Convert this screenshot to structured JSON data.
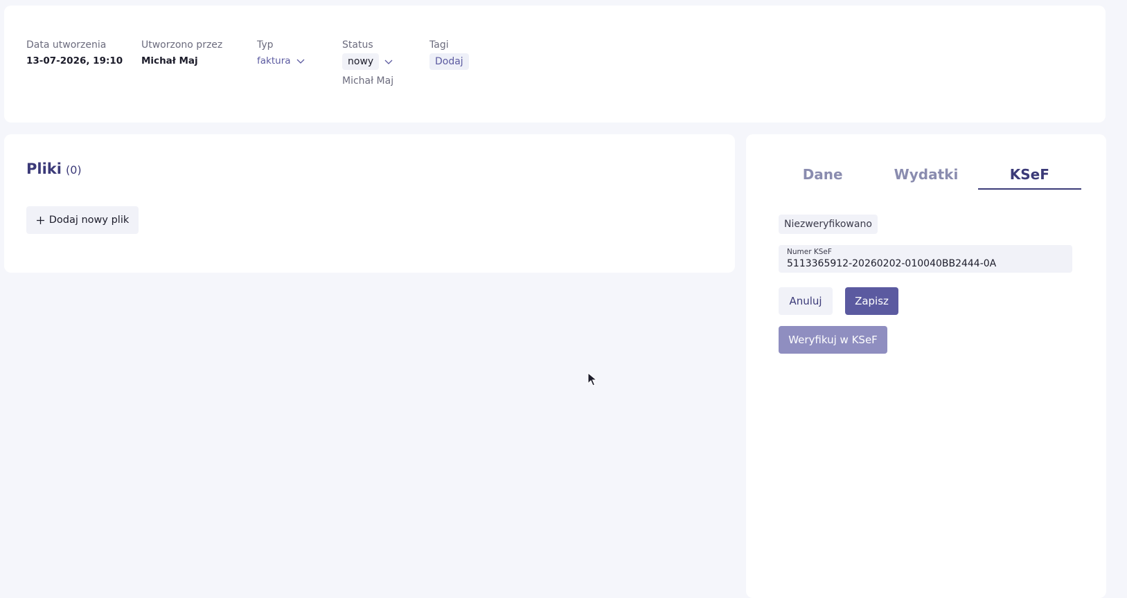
{
  "header": {
    "created_date": {
      "label": "Data utworzenia",
      "value": "13-07-2026, 19:10"
    },
    "created_by": {
      "label": "Utworzono przez",
      "value": "Michał Maj"
    },
    "type": {
      "label": "Typ",
      "value": "faktura"
    },
    "status": {
      "label": "Status",
      "value": "nowy",
      "assignee": "Michał Maj"
    },
    "tags": {
      "label": "Tagi",
      "add_label": "Dodaj"
    }
  },
  "files": {
    "title": "Pliki",
    "count": "(0)",
    "add_button": "Dodaj nowy plik"
  },
  "side_panel": {
    "tabs": [
      {
        "label": "Dane",
        "active": false
      },
      {
        "label": "Wydatki",
        "active": false
      },
      {
        "label": "KSeF",
        "active": true
      }
    ],
    "verification_status": "Niezweryfikowano",
    "ksef_number": {
      "label": "Numer KSeF",
      "value": "5113365912-20260202-010040BB2444-0A"
    },
    "cancel_button": "Anuluj",
    "save_button": "Zapisz",
    "verify_button": "Weryfikuj w KSeF"
  },
  "colors": {
    "accent": "#5b5aa0",
    "heading": "#3b3a78",
    "background": "#f5f6fb"
  }
}
